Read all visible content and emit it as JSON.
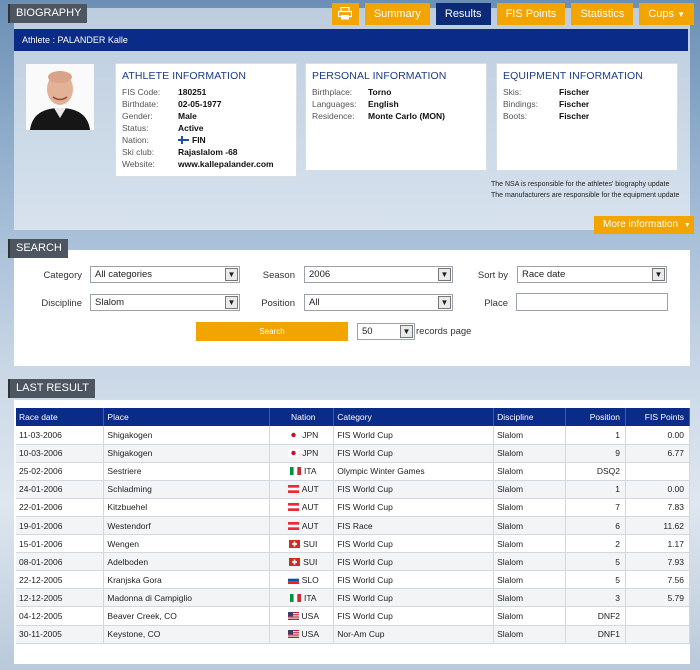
{
  "biography": {
    "tag": "BIOGRAPHY",
    "tabs": [
      "Summary",
      "Results",
      "FIS Points",
      "Statistics",
      "Cups"
    ],
    "active_tab": "Results",
    "athlete_bar": "Athlete : PALANDER Kalle",
    "athlete_info": {
      "title": "ATHLETE INFORMATION",
      "rows": [
        {
          "k": "FIS Code:",
          "v": "180251"
        },
        {
          "k": "Birthdate:",
          "v": "02-05-1977"
        },
        {
          "k": "Gender:",
          "v": "Male"
        },
        {
          "k": "Status:",
          "v": "Active"
        },
        {
          "k": "Nation:",
          "v": "FIN"
        },
        {
          "k": "Ski club:",
          "v": "Rajaslalom -68"
        },
        {
          "k": "Website:",
          "v": "www.kallepalander.com"
        }
      ]
    },
    "personal_info": {
      "title": "PERSONAL INFORMATION",
      "rows": [
        {
          "k": "Birthplace:",
          "v": "Torno"
        },
        {
          "k": "Languages:",
          "v": "English"
        },
        {
          "k": "Residence:",
          "v": "Monte Carlo (MON)"
        }
      ]
    },
    "equipment_info": {
      "title": "EQUIPMENT INFORMATION",
      "rows": [
        {
          "k": "Skis:",
          "v": "Fischer"
        },
        {
          "k": "Bindings:",
          "v": "Fischer"
        },
        {
          "k": "Boots:",
          "v": "Fischer"
        }
      ]
    },
    "notes": [
      "The NSA is responsible for the athletes' biography update",
      "The manufacturers are responsible for the equipment update"
    ],
    "more_info": "More information"
  },
  "search": {
    "tag": "SEARCH",
    "category_label": "Category",
    "category_value": "All categories",
    "season_label": "Season",
    "season_value": "2006",
    "sortby_label": "Sort by",
    "sortby_value": "Race date",
    "discipline_label": "Discipline",
    "discipline_value": "Slalom",
    "position_label": "Position",
    "position_value": "All",
    "place_label": "Place",
    "place_value": "",
    "search_button": "Search",
    "records_value": "50",
    "records_label": "records page"
  },
  "results": {
    "tag": "LAST RESULT",
    "headers": [
      "Race date",
      "Place",
      "Nation",
      "Category",
      "Discipline",
      "Position",
      "FIS Points"
    ],
    "rows": [
      {
        "date": "11-03-2006",
        "place": "Shigakogen",
        "nation": "JPN",
        "category": "FIS World Cup",
        "discipline": "Slalom",
        "position": "1",
        "points": "0.00"
      },
      {
        "date": "10-03-2006",
        "place": "Shigakogen",
        "nation": "JPN",
        "category": "FIS World Cup",
        "discipline": "Slalom",
        "position": "9",
        "points": "6.77"
      },
      {
        "date": "25-02-2006",
        "place": "Sestriere",
        "nation": "ITA",
        "category": "Olympic Winter Games",
        "discipline": "Slalom",
        "position": "DSQ2",
        "points": ""
      },
      {
        "date": "24-01-2006",
        "place": "Schladming",
        "nation": "AUT",
        "category": "FIS World Cup",
        "discipline": "Slalom",
        "position": "1",
        "points": "0.00"
      },
      {
        "date": "22-01-2006",
        "place": "Kitzbuehel",
        "nation": "AUT",
        "category": "FIS World Cup",
        "discipline": "Slalom",
        "position": "7",
        "points": "7.83"
      },
      {
        "date": "19-01-2006",
        "place": "Westendorf",
        "nation": "AUT",
        "category": "FIS Race",
        "discipline": "Slalom",
        "position": "6",
        "points": "11.62"
      },
      {
        "date": "15-01-2006",
        "place": "Wengen",
        "nation": "SUI",
        "category": "FIS World Cup",
        "discipline": "Slalom",
        "position": "2",
        "points": "1.17"
      },
      {
        "date": "08-01-2006",
        "place": "Adelboden",
        "nation": "SUI",
        "category": "FIS World Cup",
        "discipline": "Slalom",
        "position": "5",
        "points": "7.93"
      },
      {
        "date": "22-12-2005",
        "place": "Kranjska Gora",
        "nation": "SLO",
        "category": "FIS World Cup",
        "discipline": "Slalom",
        "position": "5",
        "points": "7.56"
      },
      {
        "date": "12-12-2005",
        "place": "Madonna di Campiglio",
        "nation": "ITA",
        "category": "FIS World Cup",
        "discipline": "Slalom",
        "position": "3",
        "points": "5.79"
      },
      {
        "date": "04-12-2005",
        "place": "Beaver Creek, CO",
        "nation": "USA",
        "category": "FIS World Cup",
        "discipline": "Slalom",
        "position": "DNF2",
        "points": ""
      },
      {
        "date": "30-11-2005",
        "place": "Keystone, CO",
        "nation": "USA",
        "category": "Nor-Am Cup",
        "discipline": "Slalom",
        "position": "DNF1",
        "points": ""
      }
    ]
  }
}
